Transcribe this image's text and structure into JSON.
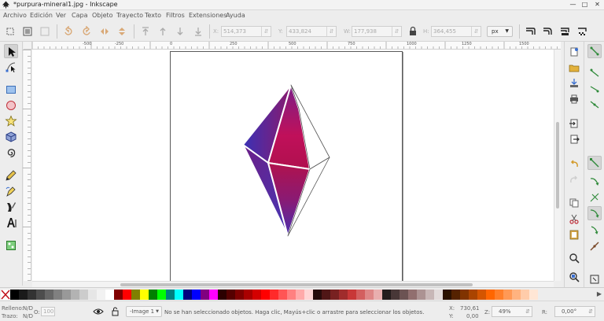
{
  "window": {
    "title": "*purpura-mineral1.jpg - Inkscape",
    "minimize": "—",
    "maximize": "□",
    "close": "✕"
  },
  "menu": [
    "Archivo",
    "Edición",
    "Ver",
    "Capa",
    "Objeto",
    "Trayecto",
    "Texto",
    "Filtros",
    "Extensiones",
    "Ayuda"
  ],
  "toolbar": {
    "x_label": "X:",
    "x_value": "514,373",
    "y_label": "Y:",
    "y_value": "433,824",
    "w_label": "W:",
    "w_value": "177,938",
    "h_label": "H:",
    "h_value": "364,455",
    "unit": "px"
  },
  "ruler": {
    "labels": [
      "-500",
      "-250",
      "0",
      "250",
      "500",
      "750",
      "1000",
      "1250",
      "1500"
    ]
  },
  "palette": {
    "colors": [
      "#000000",
      "#1a1a1a",
      "#333333",
      "#4d4d4d",
      "#666666",
      "#808080",
      "#999999",
      "#b3b3b3",
      "#cccccc",
      "#e6e6e6",
      "#f2f2f2",
      "#ffffff",
      "#800000",
      "#ff0000",
      "#808000",
      "#ffff00",
      "#008000",
      "#00ff00",
      "#008080",
      "#00ffff",
      "#000080",
      "#0000ff",
      "#800080",
      "#ff00ff",
      "#2b0000",
      "#550000",
      "#800000",
      "#aa0000",
      "#d40000",
      "#ff0000",
      "#ff2a2a",
      "#ff5555",
      "#ff8080",
      "#ffaaaa",
      "#ffd5d5",
      "#280b0b",
      "#501616",
      "#782121",
      "#a02c2c",
      "#c83737",
      "#d35f5f",
      "#de8787",
      "#e9afaf",
      "#241c1c",
      "#483737",
      "#6c5353",
      "#916f6f",
      "#ac9393",
      "#c8b7b7",
      "#e3dbdb",
      "#2b1100",
      "#552200",
      "#803300",
      "#aa4400",
      "#d45500",
      "#ff6600",
      "#ff7f2a",
      "#ff9955",
      "#ffb380",
      "#ffccaa",
      "#ffe6d5"
    ]
  },
  "status": {
    "fill_label": "Relleno:",
    "fill_value": "N/D",
    "stroke_label": "Trazo:",
    "stroke_value": "N/D",
    "opacity_label": "O:",
    "opacity_value": "100",
    "layer": "-Image 1",
    "message": "No se han seleccionado objetos. Haga clic, Mayús+clic o arrastre para seleccionar los objetos.",
    "x_label": "X:",
    "x_value": "730,61",
    "y_label": "Y:",
    "y_value": "0,00",
    "zoom_label": "Z:",
    "zoom_value": "49%",
    "rotation_label": "R:",
    "rotation_value": "0,00°"
  },
  "colors": {
    "gem_purple": "#4a2cae",
    "gem_magenta": "#b3124f",
    "gem_violet": "#7a1f8a"
  }
}
